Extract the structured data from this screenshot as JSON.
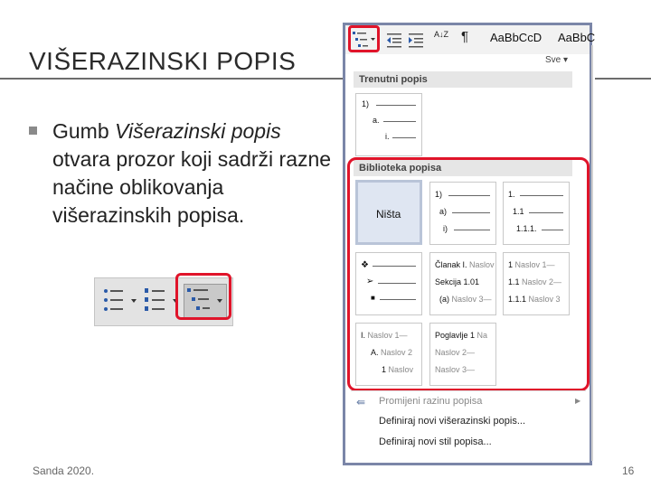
{
  "slide": {
    "title": "VIŠERAZINSKI POPIS",
    "bullet_intro": "Gumb ",
    "bullet_em": "Višerazinski popis",
    "bullet_rest": " otvara prozor koji sadrži razne načine oblikovanja višerazinskih popisa.",
    "footer_left": "Sanda 2020.",
    "page_number": "16"
  },
  "ribbon": {
    "style1": "AaBbCcD",
    "style2": "AaBbC",
    "pilcrow": "¶",
    "sort": "A↓Z"
  },
  "dropdown": {
    "more_label": "Sve ▾",
    "current_section": "Trenutni popis",
    "current_levels": [
      "1)",
      "a.",
      "i."
    ],
    "library_section": "Biblioteka popisa",
    "tiles": {
      "none": "Ništa",
      "t1": [
        "1)",
        "a)",
        "i)"
      ],
      "t2": [
        "1.",
        "1.1",
        "1.1.1."
      ],
      "t4": [
        "Članak I.",
        "Sekcija 1.01",
        "(a)"
      ],
      "t4_hint": [
        "Naslov",
        "Naslov",
        "Naslov 3—"
      ],
      "t5": [
        "1",
        "1.1",
        "1.1.1"
      ],
      "t5_hint": [
        "Naslov 1—",
        "Naslov 2—",
        "Naslov 3"
      ],
      "t6": [
        "I.",
        "A.",
        "1"
      ],
      "t6_hint": [
        "Naslov 1—",
        "Naslov 2",
        "Naslov"
      ],
      "t7": [
        "Poglavlje 1",
        "Naslov 2—",
        "Naslov 3—"
      ],
      "t7_hint": [
        "Na",
        "",
        ""
      ]
    },
    "menu": [
      "Promijeni razinu popisa",
      "Definiraj novi višerazinski popis...",
      "Definiraj novi stil popisa..."
    ]
  },
  "colors": {
    "highlight": "#e0142a",
    "frame": "#7b86a8",
    "selected_tile": "#dfe6f2"
  }
}
